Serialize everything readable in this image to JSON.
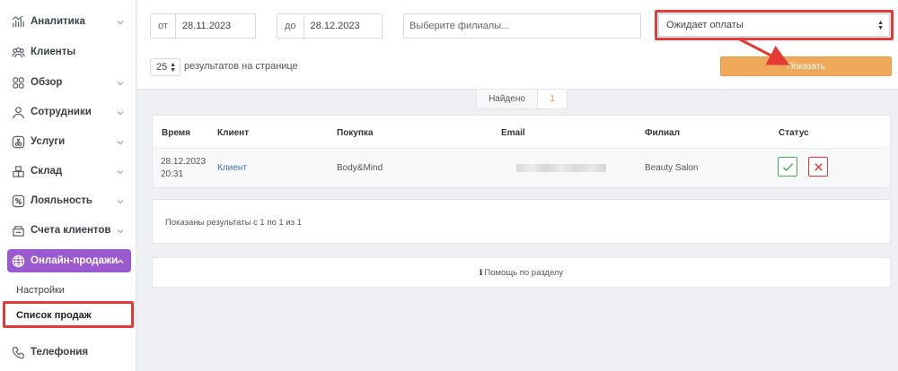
{
  "sidebar": {
    "items": [
      {
        "label": "Аналитика",
        "icon": "analytics-icon",
        "has_chevron": true
      },
      {
        "label": "Клиенты",
        "icon": "clients-icon",
        "has_chevron": false
      },
      {
        "label": "Обзор",
        "icon": "overview-icon",
        "has_chevron": true
      },
      {
        "label": "Сотрудники",
        "icon": "employees-icon",
        "has_chevron": true
      },
      {
        "label": "Услуги",
        "icon": "services-icon",
        "has_chevron": true
      },
      {
        "label": "Склад",
        "icon": "warehouse-icon",
        "has_chevron": true
      },
      {
        "label": "Лояльность",
        "icon": "loyalty-icon",
        "has_chevron": true
      },
      {
        "label": "Счета клиентов",
        "icon": "client-accounts-icon",
        "has_chevron": true
      },
      {
        "label": "Онлайн-продажи",
        "icon": "globe-icon",
        "has_chevron": true,
        "active": true
      },
      {
        "label": "Телефония",
        "icon": "phone-icon",
        "has_chevron": false
      }
    ],
    "submenu": [
      {
        "label": "Настройки"
      },
      {
        "label": "Список продаж",
        "current": true
      }
    ]
  },
  "filters": {
    "from_prefix": "от",
    "from_value": "28.11.2023",
    "to_prefix": "до",
    "to_value": "28.12.2023",
    "branch_placeholder": "Выберите филиалы...",
    "status_value": "Ожидает оплаты",
    "per_page_value": "25",
    "per_page_label": "результатов на странице",
    "show_button": "Показать"
  },
  "found": {
    "label": "Найдено",
    "count": "1"
  },
  "table": {
    "headers": [
      "Время",
      "Клиент",
      "Покупка",
      "Email",
      "Филиал",
      "Статус"
    ],
    "rows": [
      {
        "time_date": "28.12.2023",
        "time_clock": "20:31",
        "client": "Клиент",
        "purchase": "Body&Mind",
        "email": "",
        "branch": "Beauty Salon"
      }
    ]
  },
  "results_text": "Показаны результаты с 1 по 1 из 1",
  "help_text": "Помощь по разделу",
  "colors": {
    "accent": "#9b59d0",
    "button": "#f0a95a",
    "highlight": "#e53935",
    "ok": "#4caf50",
    "link": "#3d6fb6"
  }
}
